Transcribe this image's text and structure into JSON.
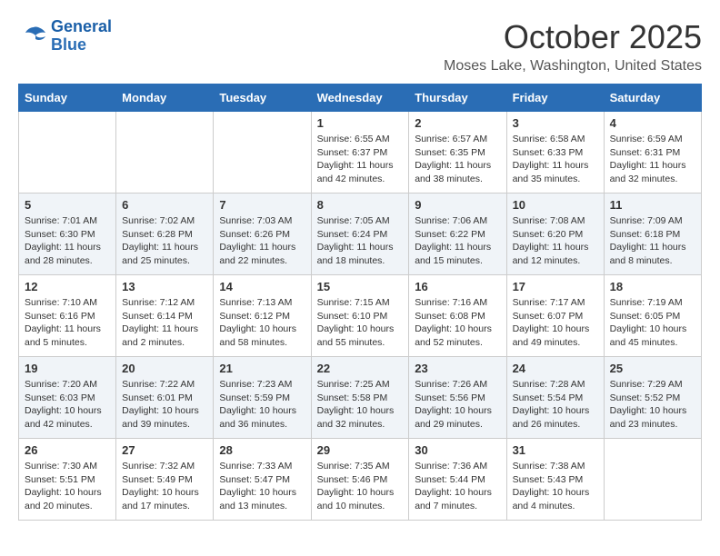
{
  "logo": {
    "line1": "General",
    "line2": "Blue"
  },
  "title": "October 2025",
  "subtitle": "Moses Lake, Washington, United States",
  "headers": [
    "Sunday",
    "Monday",
    "Tuesday",
    "Wednesday",
    "Thursday",
    "Friday",
    "Saturday"
  ],
  "weeks": [
    [
      {
        "day": "",
        "info": ""
      },
      {
        "day": "",
        "info": ""
      },
      {
        "day": "",
        "info": ""
      },
      {
        "day": "1",
        "info": "Sunrise: 6:55 AM\nSunset: 6:37 PM\nDaylight: 11 hours and 42 minutes."
      },
      {
        "day": "2",
        "info": "Sunrise: 6:57 AM\nSunset: 6:35 PM\nDaylight: 11 hours and 38 minutes."
      },
      {
        "day": "3",
        "info": "Sunrise: 6:58 AM\nSunset: 6:33 PM\nDaylight: 11 hours and 35 minutes."
      },
      {
        "day": "4",
        "info": "Sunrise: 6:59 AM\nSunset: 6:31 PM\nDaylight: 11 hours and 32 minutes."
      }
    ],
    [
      {
        "day": "5",
        "info": "Sunrise: 7:01 AM\nSunset: 6:30 PM\nDaylight: 11 hours and 28 minutes."
      },
      {
        "day": "6",
        "info": "Sunrise: 7:02 AM\nSunset: 6:28 PM\nDaylight: 11 hours and 25 minutes."
      },
      {
        "day": "7",
        "info": "Sunrise: 7:03 AM\nSunset: 6:26 PM\nDaylight: 11 hours and 22 minutes."
      },
      {
        "day": "8",
        "info": "Sunrise: 7:05 AM\nSunset: 6:24 PM\nDaylight: 11 hours and 18 minutes."
      },
      {
        "day": "9",
        "info": "Sunrise: 7:06 AM\nSunset: 6:22 PM\nDaylight: 11 hours and 15 minutes."
      },
      {
        "day": "10",
        "info": "Sunrise: 7:08 AM\nSunset: 6:20 PM\nDaylight: 11 hours and 12 minutes."
      },
      {
        "day": "11",
        "info": "Sunrise: 7:09 AM\nSunset: 6:18 PM\nDaylight: 11 hours and 8 minutes."
      }
    ],
    [
      {
        "day": "12",
        "info": "Sunrise: 7:10 AM\nSunset: 6:16 PM\nDaylight: 11 hours and 5 minutes."
      },
      {
        "day": "13",
        "info": "Sunrise: 7:12 AM\nSunset: 6:14 PM\nDaylight: 11 hours and 2 minutes."
      },
      {
        "day": "14",
        "info": "Sunrise: 7:13 AM\nSunset: 6:12 PM\nDaylight: 10 hours and 58 minutes."
      },
      {
        "day": "15",
        "info": "Sunrise: 7:15 AM\nSunset: 6:10 PM\nDaylight: 10 hours and 55 minutes."
      },
      {
        "day": "16",
        "info": "Sunrise: 7:16 AM\nSunset: 6:08 PM\nDaylight: 10 hours and 52 minutes."
      },
      {
        "day": "17",
        "info": "Sunrise: 7:17 AM\nSunset: 6:07 PM\nDaylight: 10 hours and 49 minutes."
      },
      {
        "day": "18",
        "info": "Sunrise: 7:19 AM\nSunset: 6:05 PM\nDaylight: 10 hours and 45 minutes."
      }
    ],
    [
      {
        "day": "19",
        "info": "Sunrise: 7:20 AM\nSunset: 6:03 PM\nDaylight: 10 hours and 42 minutes."
      },
      {
        "day": "20",
        "info": "Sunrise: 7:22 AM\nSunset: 6:01 PM\nDaylight: 10 hours and 39 minutes."
      },
      {
        "day": "21",
        "info": "Sunrise: 7:23 AM\nSunset: 5:59 PM\nDaylight: 10 hours and 36 minutes."
      },
      {
        "day": "22",
        "info": "Sunrise: 7:25 AM\nSunset: 5:58 PM\nDaylight: 10 hours and 32 minutes."
      },
      {
        "day": "23",
        "info": "Sunrise: 7:26 AM\nSunset: 5:56 PM\nDaylight: 10 hours and 29 minutes."
      },
      {
        "day": "24",
        "info": "Sunrise: 7:28 AM\nSunset: 5:54 PM\nDaylight: 10 hours and 26 minutes."
      },
      {
        "day": "25",
        "info": "Sunrise: 7:29 AM\nSunset: 5:52 PM\nDaylight: 10 hours and 23 minutes."
      }
    ],
    [
      {
        "day": "26",
        "info": "Sunrise: 7:30 AM\nSunset: 5:51 PM\nDaylight: 10 hours and 20 minutes."
      },
      {
        "day": "27",
        "info": "Sunrise: 7:32 AM\nSunset: 5:49 PM\nDaylight: 10 hours and 17 minutes."
      },
      {
        "day": "28",
        "info": "Sunrise: 7:33 AM\nSunset: 5:47 PM\nDaylight: 10 hours and 13 minutes."
      },
      {
        "day": "29",
        "info": "Sunrise: 7:35 AM\nSunset: 5:46 PM\nDaylight: 10 hours and 10 minutes."
      },
      {
        "day": "30",
        "info": "Sunrise: 7:36 AM\nSunset: 5:44 PM\nDaylight: 10 hours and 7 minutes."
      },
      {
        "day": "31",
        "info": "Sunrise: 7:38 AM\nSunset: 5:43 PM\nDaylight: 10 hours and 4 minutes."
      },
      {
        "day": "",
        "info": ""
      }
    ]
  ]
}
